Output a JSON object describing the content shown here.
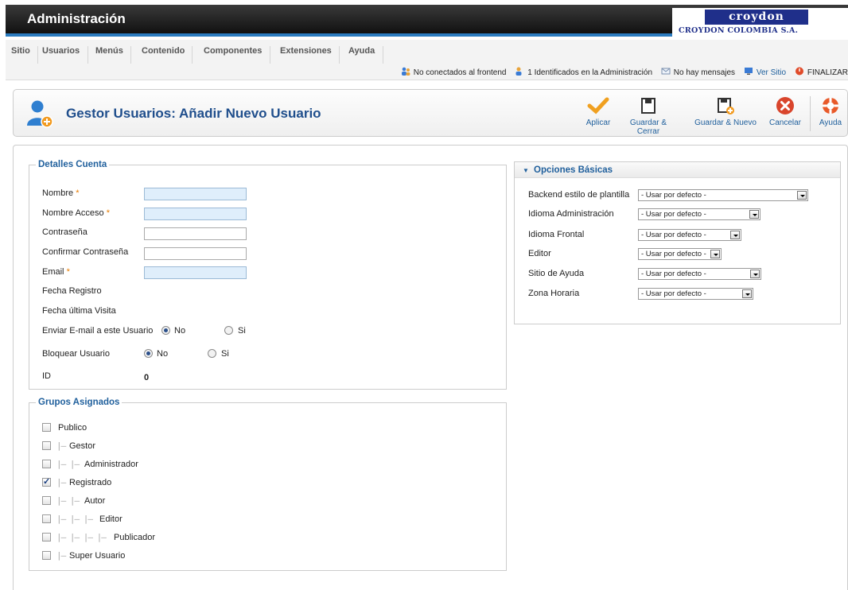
{
  "header": {
    "title": "Administración",
    "logo": {
      "brand": "croydon",
      "subtitle": "CROYDON COLOMBIA S.A."
    }
  },
  "menu": {
    "items": [
      {
        "label": "Sitio"
      },
      {
        "label": "Usuarios"
      },
      {
        "label": "Menús"
      },
      {
        "label": "Contenido"
      },
      {
        "label": "Componentes"
      },
      {
        "label": "Extensiones"
      },
      {
        "label": "Ayuda"
      }
    ]
  },
  "status": {
    "frontend": "No conectados al frontend",
    "admin": "1 Identificados en la Administración",
    "messages": "No hay mensajes",
    "view_site": "Ver Sitio",
    "logout": "FINALIZAR"
  },
  "toolbar": {
    "title": "Gestor Usuarios: Añadir Nuevo Usuario",
    "buttons": {
      "apply": "Aplicar",
      "save_close": "Guardar & Cerrar",
      "save_new": "Guardar & Nuevo",
      "cancel": "Cancelar",
      "help": "Ayuda"
    }
  },
  "account": {
    "legend": "Detalles Cuenta",
    "name_label": "Nombre",
    "username_label": "Nombre Acceso",
    "password_label": "Contraseña",
    "confirm_label": "Confirmar Contraseña",
    "email_label": "Email",
    "required_mark": "*",
    "register_date_label": "Fecha Registro",
    "last_visit_label": "Fecha última Visita",
    "send_email_label": "Enviar E-mail a este Usuario",
    "block_label": "Bloquear Usuario",
    "no": "No",
    "yes": "Si",
    "id_label": "ID",
    "id_value": "0",
    "values": {
      "name": "",
      "username": "",
      "password": "",
      "confirm": "",
      "email": ""
    },
    "send_email": "No",
    "block": "No"
  },
  "groups": {
    "legend": "Grupos Asignados",
    "items": [
      {
        "label": "Publico",
        "tree": "",
        "checked": false
      },
      {
        "label": "Gestor",
        "tree": "|—",
        "checked": false
      },
      {
        "label": "Administrador",
        "tree": "|— |—",
        "checked": false
      },
      {
        "label": "Registrado",
        "tree": "|—",
        "checked": true
      },
      {
        "label": "Autor",
        "tree": "|— |—",
        "checked": false
      },
      {
        "label": "Editor",
        "tree": "|— |— |—",
        "checked": false
      },
      {
        "label": "Publicador",
        "tree": "|— |— |— |—",
        "checked": false
      },
      {
        "label": "Super Usuario",
        "tree": "|—",
        "checked": false
      }
    ]
  },
  "options": {
    "title": "Opciones Básicas",
    "items": [
      {
        "label": "Backend estilo de plantilla",
        "value": "- Usar por defecto -"
      },
      {
        "label": "Idioma Administración",
        "value": "- Usar por defecto -"
      },
      {
        "label": "Idioma Frontal",
        "value": "- Usar por defecto -"
      },
      {
        "label": "Editor",
        "value": "- Usar por defecto -"
      },
      {
        "label": "Sitio de Ayuda",
        "value": "- Usar por defecto -"
      },
      {
        "label": "Zona Horaria",
        "value": "- Usar por defecto -"
      }
    ]
  },
  "colors": {
    "accent": "#2b7bbf",
    "title": "#1f4e8c",
    "link": "#1f5f9c",
    "required": "#e87c00"
  }
}
